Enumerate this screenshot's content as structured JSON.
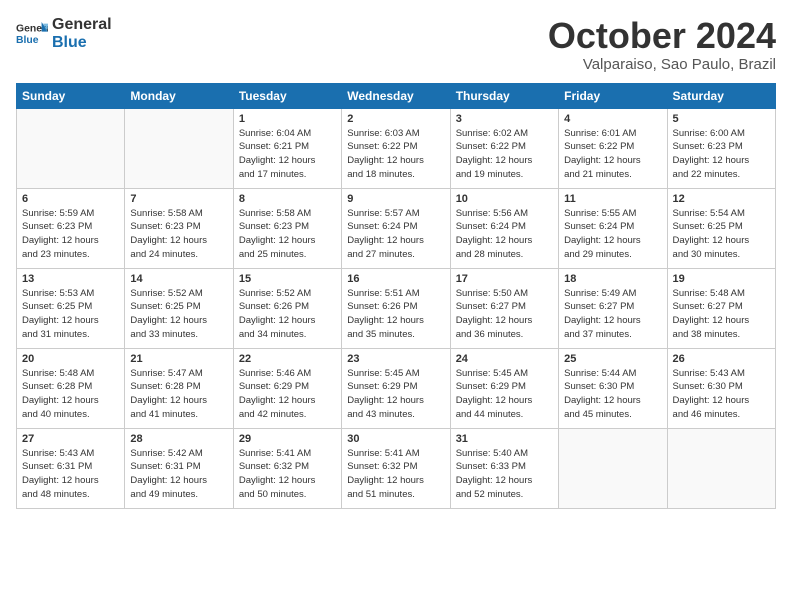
{
  "header": {
    "logo_general": "General",
    "logo_blue": "Blue",
    "month_title": "October 2024",
    "location": "Valparaiso, Sao Paulo, Brazil"
  },
  "weekdays": [
    "Sunday",
    "Monday",
    "Tuesday",
    "Wednesday",
    "Thursday",
    "Friday",
    "Saturday"
  ],
  "weeks": [
    [
      {
        "day": "",
        "info": ""
      },
      {
        "day": "",
        "info": ""
      },
      {
        "day": "1",
        "info": "Sunrise: 6:04 AM\nSunset: 6:21 PM\nDaylight: 12 hours\nand 17 minutes."
      },
      {
        "day": "2",
        "info": "Sunrise: 6:03 AM\nSunset: 6:22 PM\nDaylight: 12 hours\nand 18 minutes."
      },
      {
        "day": "3",
        "info": "Sunrise: 6:02 AM\nSunset: 6:22 PM\nDaylight: 12 hours\nand 19 minutes."
      },
      {
        "day": "4",
        "info": "Sunrise: 6:01 AM\nSunset: 6:22 PM\nDaylight: 12 hours\nand 21 minutes."
      },
      {
        "day": "5",
        "info": "Sunrise: 6:00 AM\nSunset: 6:23 PM\nDaylight: 12 hours\nand 22 minutes."
      }
    ],
    [
      {
        "day": "6",
        "info": "Sunrise: 5:59 AM\nSunset: 6:23 PM\nDaylight: 12 hours\nand 23 minutes."
      },
      {
        "day": "7",
        "info": "Sunrise: 5:58 AM\nSunset: 6:23 PM\nDaylight: 12 hours\nand 24 minutes."
      },
      {
        "day": "8",
        "info": "Sunrise: 5:58 AM\nSunset: 6:23 PM\nDaylight: 12 hours\nand 25 minutes."
      },
      {
        "day": "9",
        "info": "Sunrise: 5:57 AM\nSunset: 6:24 PM\nDaylight: 12 hours\nand 27 minutes."
      },
      {
        "day": "10",
        "info": "Sunrise: 5:56 AM\nSunset: 6:24 PM\nDaylight: 12 hours\nand 28 minutes."
      },
      {
        "day": "11",
        "info": "Sunrise: 5:55 AM\nSunset: 6:24 PM\nDaylight: 12 hours\nand 29 minutes."
      },
      {
        "day": "12",
        "info": "Sunrise: 5:54 AM\nSunset: 6:25 PM\nDaylight: 12 hours\nand 30 minutes."
      }
    ],
    [
      {
        "day": "13",
        "info": "Sunrise: 5:53 AM\nSunset: 6:25 PM\nDaylight: 12 hours\nand 31 minutes."
      },
      {
        "day": "14",
        "info": "Sunrise: 5:52 AM\nSunset: 6:25 PM\nDaylight: 12 hours\nand 33 minutes."
      },
      {
        "day": "15",
        "info": "Sunrise: 5:52 AM\nSunset: 6:26 PM\nDaylight: 12 hours\nand 34 minutes."
      },
      {
        "day": "16",
        "info": "Sunrise: 5:51 AM\nSunset: 6:26 PM\nDaylight: 12 hours\nand 35 minutes."
      },
      {
        "day": "17",
        "info": "Sunrise: 5:50 AM\nSunset: 6:27 PM\nDaylight: 12 hours\nand 36 minutes."
      },
      {
        "day": "18",
        "info": "Sunrise: 5:49 AM\nSunset: 6:27 PM\nDaylight: 12 hours\nand 37 minutes."
      },
      {
        "day": "19",
        "info": "Sunrise: 5:48 AM\nSunset: 6:27 PM\nDaylight: 12 hours\nand 38 minutes."
      }
    ],
    [
      {
        "day": "20",
        "info": "Sunrise: 5:48 AM\nSunset: 6:28 PM\nDaylight: 12 hours\nand 40 minutes."
      },
      {
        "day": "21",
        "info": "Sunrise: 5:47 AM\nSunset: 6:28 PM\nDaylight: 12 hours\nand 41 minutes."
      },
      {
        "day": "22",
        "info": "Sunrise: 5:46 AM\nSunset: 6:29 PM\nDaylight: 12 hours\nand 42 minutes."
      },
      {
        "day": "23",
        "info": "Sunrise: 5:45 AM\nSunset: 6:29 PM\nDaylight: 12 hours\nand 43 minutes."
      },
      {
        "day": "24",
        "info": "Sunrise: 5:45 AM\nSunset: 6:29 PM\nDaylight: 12 hours\nand 44 minutes."
      },
      {
        "day": "25",
        "info": "Sunrise: 5:44 AM\nSunset: 6:30 PM\nDaylight: 12 hours\nand 45 minutes."
      },
      {
        "day": "26",
        "info": "Sunrise: 5:43 AM\nSunset: 6:30 PM\nDaylight: 12 hours\nand 46 minutes."
      }
    ],
    [
      {
        "day": "27",
        "info": "Sunrise: 5:43 AM\nSunset: 6:31 PM\nDaylight: 12 hours\nand 48 minutes."
      },
      {
        "day": "28",
        "info": "Sunrise: 5:42 AM\nSunset: 6:31 PM\nDaylight: 12 hours\nand 49 minutes."
      },
      {
        "day": "29",
        "info": "Sunrise: 5:41 AM\nSunset: 6:32 PM\nDaylight: 12 hours\nand 50 minutes."
      },
      {
        "day": "30",
        "info": "Sunrise: 5:41 AM\nSunset: 6:32 PM\nDaylight: 12 hours\nand 51 minutes."
      },
      {
        "day": "31",
        "info": "Sunrise: 5:40 AM\nSunset: 6:33 PM\nDaylight: 12 hours\nand 52 minutes."
      },
      {
        "day": "",
        "info": ""
      },
      {
        "day": "",
        "info": ""
      }
    ]
  ]
}
